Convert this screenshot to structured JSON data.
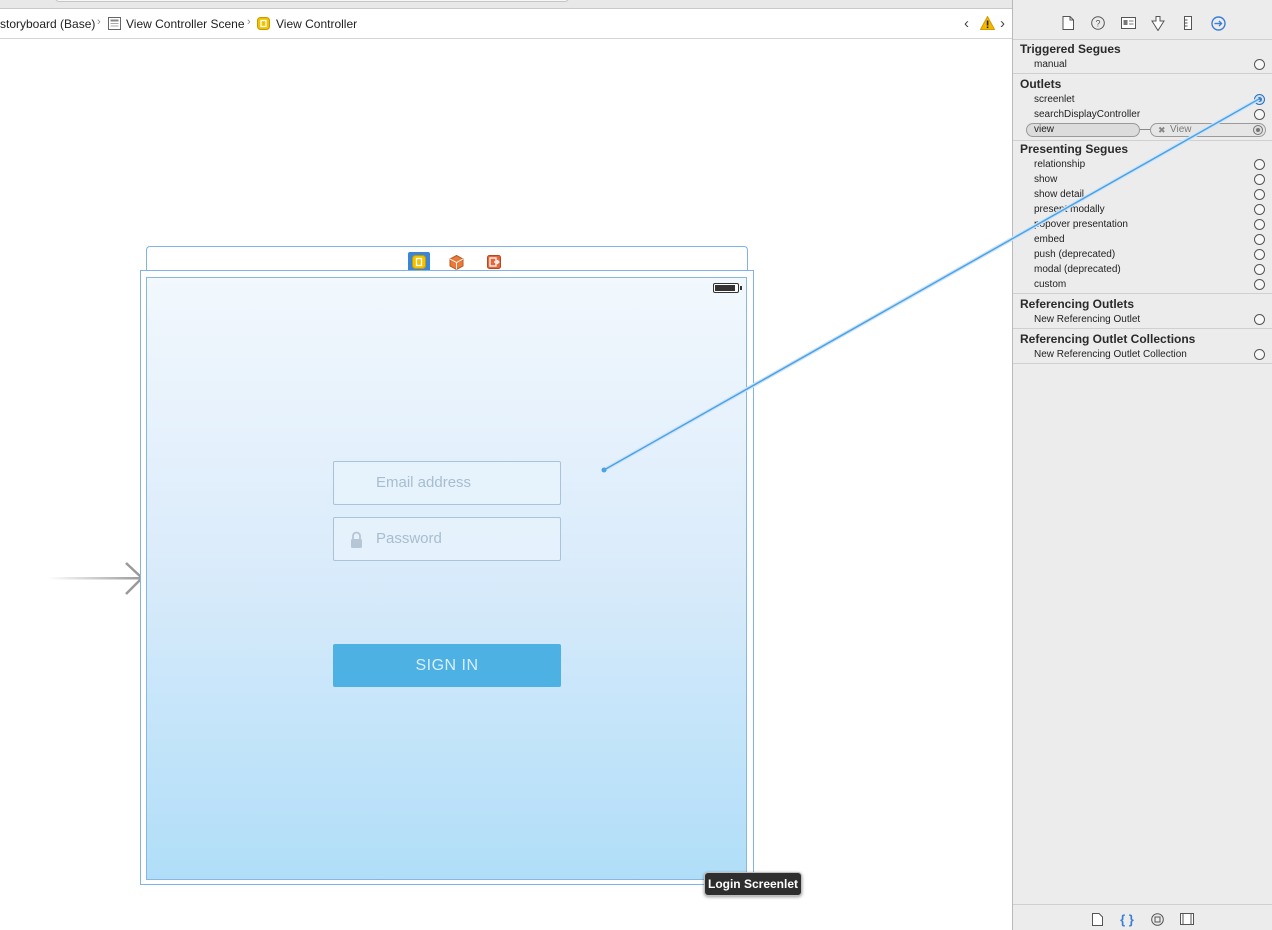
{
  "jumpbar": {
    "crumbs": [
      {
        "label": "storyboard (Base)",
        "icon": "storyboard-icon"
      },
      {
        "label": "View Controller Scene",
        "icon": "scene-icon"
      },
      {
        "label": "View Controller",
        "icon": "view-controller-icon"
      }
    ],
    "warning_icon": "warning-icon",
    "warning_color": "#f5b800"
  },
  "scene": {
    "dock_icons": [
      "view-controller-icon",
      "first-responder-icon",
      "exit-icon"
    ],
    "email_placeholder": "Email address",
    "password_placeholder": "Password",
    "signin_label": "SIGN IN",
    "tooltip": "Login Screenlet"
  },
  "inspector": {
    "tabs": [
      "file-inspector-icon",
      "quick-help-icon",
      "identity-inspector-icon",
      "attributes-inspector-icon",
      "size-inspector-icon",
      "connections-inspector-icon"
    ],
    "active_tab": "connections-inspector-icon",
    "accent_color": "#3a7ed6",
    "sections": {
      "triggered_segues": {
        "title": "Triggered Segues",
        "items": [
          "manual"
        ]
      },
      "outlets": {
        "title": "Outlets",
        "items": [
          "screenlet",
          "searchDisplayController"
        ],
        "connected": {
          "name": "view",
          "target": "View"
        }
      },
      "presenting_segues": {
        "title": "Presenting Segues",
        "items": [
          "relationship",
          "show",
          "show detail",
          "present modally",
          "popover presentation",
          "embed",
          "push (deprecated)",
          "modal (deprecated)",
          "custom"
        ]
      },
      "referencing_outlets": {
        "title": "Referencing Outlets",
        "items": [
          "New Referencing Outlet"
        ]
      },
      "referencing_outlet_collections": {
        "title": "Referencing Outlet Collections",
        "items": [
          "New Referencing Outlet Collection"
        ]
      }
    },
    "library_tabs": [
      "file-template-icon",
      "code-snippet-icon",
      "object-library-icon",
      "media-library-icon"
    ],
    "active_library_tab": "code-snippet-icon"
  }
}
